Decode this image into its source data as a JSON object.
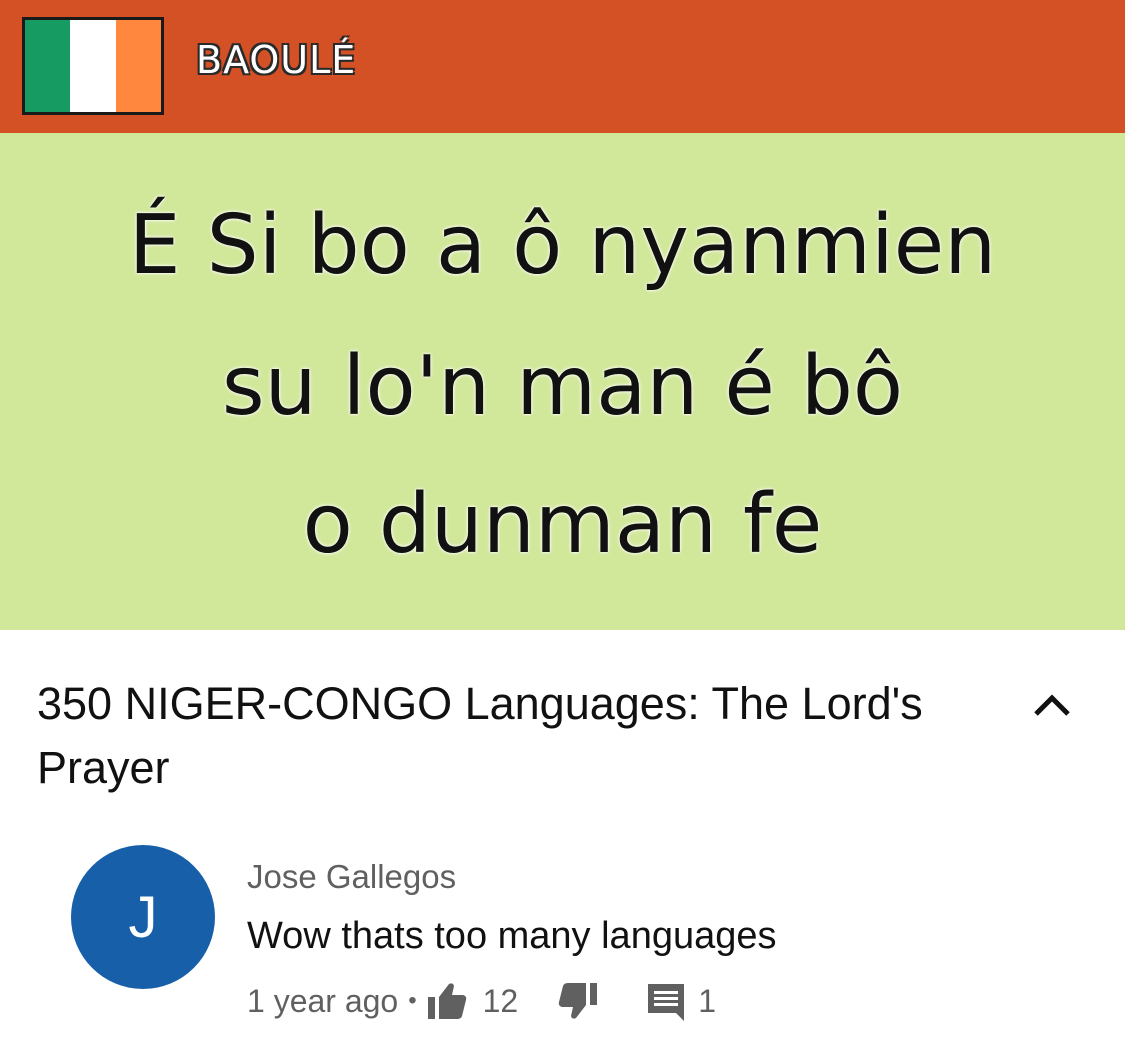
{
  "video": {
    "banner": {
      "language_label": "BAOULÉ",
      "flag_colors": [
        "#169b62",
        "#ffffff",
        "#ff883e"
      ]
    },
    "prayer_text": {
      "lines": [
        "É Si bo a ô nyanmien",
        "su lo'n man é bô",
        "o dunman fe"
      ]
    },
    "colors": {
      "banner": "#d35124",
      "panel": "#d1e79a"
    }
  },
  "title": {
    "text": "350 NIGER-CONGO Languages: The Lord's Prayer",
    "collapse_icon": "chevron-up-icon"
  },
  "comment": {
    "avatar_letter": "J",
    "avatar_color": "#1760a9",
    "author": "Jose Gallegos",
    "text": "Wow thats too many languages",
    "time": "1 year ago",
    "separator": "•",
    "likes": "12",
    "replies": "1",
    "icons": [
      "thumbs-up-icon",
      "thumbs-down-icon",
      "comment-icon"
    ]
  }
}
